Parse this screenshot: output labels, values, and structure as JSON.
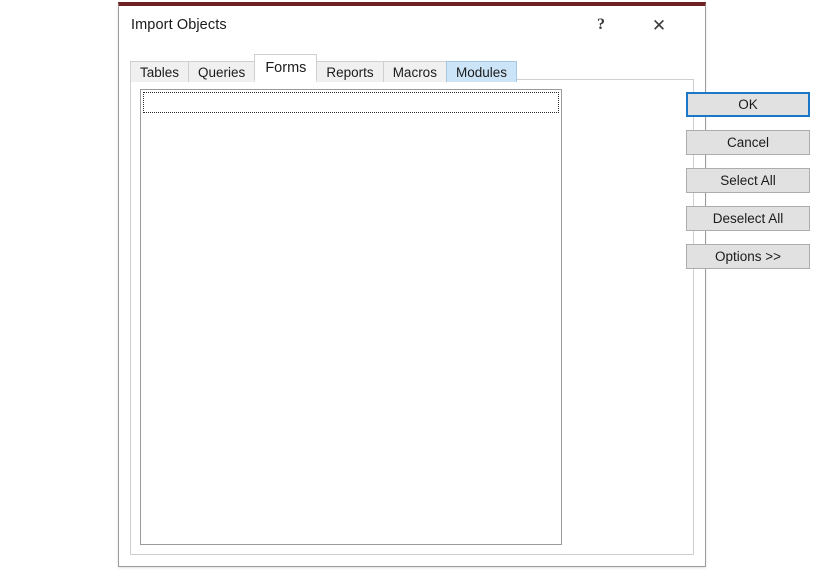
{
  "window": {
    "title": "Import Objects",
    "titlebar_buttons": [
      {
        "name": "help-button",
        "glyph": "?",
        "icon": "question-mark-icon"
      },
      {
        "name": "close-button",
        "glyph": "✕",
        "icon": "close-icon"
      }
    ],
    "accent_top_border": "#6e2222",
    "background": "#ffffff"
  },
  "tabs": {
    "items": [
      {
        "label": "Tables",
        "state": "normal"
      },
      {
        "label": "Queries",
        "state": "normal"
      },
      {
        "label": "Forms",
        "state": "active"
      },
      {
        "label": "Reports",
        "state": "normal"
      },
      {
        "label": "Macros",
        "state": "normal"
      },
      {
        "label": "Modules",
        "state": "hovered"
      }
    ],
    "selected": "Forms",
    "hover_color": "#cce4f7"
  },
  "list": {
    "items": [],
    "focused_row_index": 0,
    "empty": true
  },
  "buttons": [
    {
      "label": "OK",
      "name": "ok-button",
      "focused": true
    },
    {
      "label": "Cancel",
      "name": "cancel-button",
      "focused": false
    },
    {
      "label": "Select All",
      "name": "select-all-button",
      "focused": false
    },
    {
      "label": "Deselect All",
      "name": "deselect-all-button",
      "focused": false
    },
    {
      "label": "Options >>",
      "name": "options-button",
      "focused": false
    }
  ],
  "colors": {
    "focus_blue": "#1b77c8",
    "button_face": "#e1e1e1",
    "button_border": "#adadad",
    "panel_border": "#cfcfcf"
  }
}
